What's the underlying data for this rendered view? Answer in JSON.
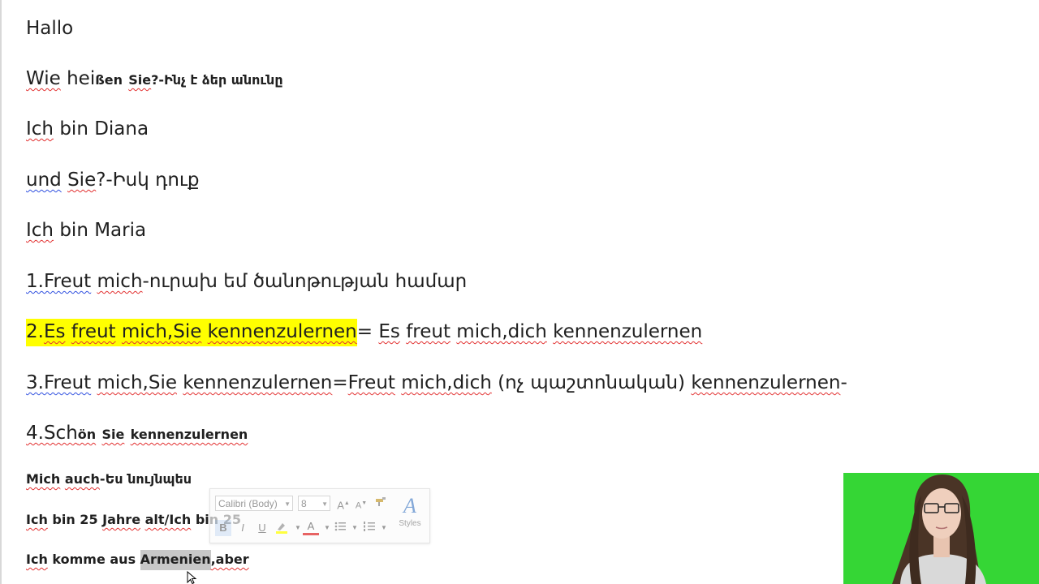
{
  "document": {
    "line1": "Hallo",
    "line2": {
      "wie": "Wie",
      "hei": "hei",
      "ssen": "ßen",
      "sie": "Sie",
      "arm": "?-Ինչ է ձեր անունը"
    },
    "line3": {
      "ich": "Ich",
      "rest": "bin Diana"
    },
    "line4": {
      "und": "und",
      "sie": "Sie",
      "arm": "?-Իսկ դուք"
    },
    "line5": {
      "ich": "Ich",
      "rest": "bin Maria"
    },
    "line6": {
      "num": "1.Freut",
      "mich": "mich",
      "arm": "-ուրախ եմ ծանոթության համար"
    },
    "line7": {
      "num": "2.",
      "es": "Es",
      "freut": "freut",
      "mich": "mich,Sie",
      "kenn": "kennenzulernen",
      "eq": "=",
      "es2": "Es",
      "freut2": "freut",
      "mich2": "mich,dich",
      "kenn2": "kennenzulernen"
    },
    "line8": {
      "num": "3.Freut",
      "mich": "mich,Sie",
      "kenn": "kennenzulernen",
      "eq": "=",
      "freut2": "Freut",
      "mich2": "mich,dich",
      "arm": "(ոչ պաշտոնական)",
      "kenn2": "kennenzulernen",
      "dash": "-"
    },
    "line9": {
      "num": "4.Sch",
      "on": "ön",
      "sie": "Sie",
      "kenn": "kennenzulernen"
    },
    "line10": {
      "mich": "Mich",
      "auch": "auch",
      "arm": "-Ես նույնպես"
    },
    "line11": {
      "ich": "Ich",
      "mid": "bin 25",
      "jahre": "Jahre",
      "alt": "alt/Ich",
      "tail": "bin 25"
    },
    "line12": {
      "ich": "Ich",
      "komme": "komme aus",
      "armenien": "Armenien",
      "aber": ",aber"
    }
  },
  "mini_toolbar": {
    "font_name": "Calibri (Body)",
    "font_size": "8",
    "grow_font": "A",
    "shrink_font": "A",
    "bold": "B",
    "italic": "I",
    "underline": "U",
    "font_color": "A",
    "styles_label": "Styles"
  },
  "colors": {
    "highlight": "#ffff00",
    "spell_error": "#e23030",
    "grammar_error": "#3050e0",
    "webcam_bg": "#35d635"
  }
}
